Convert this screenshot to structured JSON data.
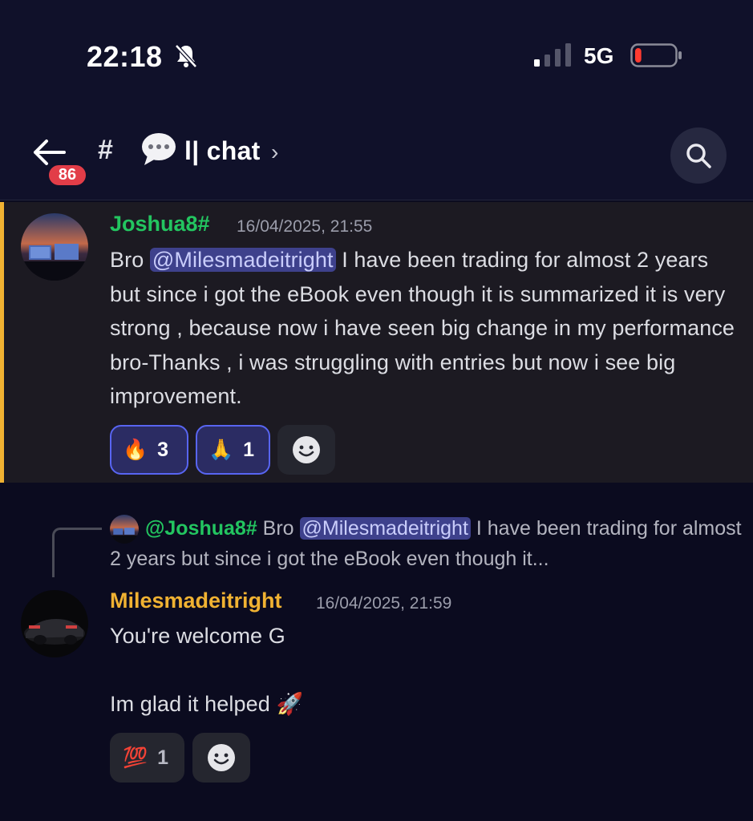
{
  "status_bar": {
    "time": "22:18",
    "network": "5G",
    "bell_icon": "bell-slash-icon",
    "battery_level_percent": 10
  },
  "header": {
    "unread_badge": "86",
    "channel_hash": "#",
    "channel_emoji": "speech-bubble-icon",
    "channel_name": "l| chat",
    "chevron": "›"
  },
  "messages": [
    {
      "author": "Joshua8#",
      "author_color": "#23c560",
      "timestamp": "16/04/2025, 21:55",
      "text_before_mention": "Bro ",
      "mention": "@Milesmadeitright",
      "text_after_mention": " I have been trading for almost 2 years but since i got the eBook even though  it is summarized it is very strong , because now i have seen big change in my performance bro-Thanks ,  i was struggling with entries but now i see big improvement.",
      "reactions": [
        {
          "emoji": "🔥",
          "count": "3",
          "me": true
        },
        {
          "emoji": "🙏",
          "count": "1",
          "me": true
        }
      ]
    },
    {
      "reply_to": {
        "author": "@Joshua8#",
        "text_before_mention": " Bro ",
        "mention": "@Milesmadeitright",
        "text_after_mention": " I have been trading for almost 2 years but since i got the eBook even though  it..."
      },
      "author": "Milesmadeitright",
      "author_color": "#f0b232",
      "timestamp": "16/04/2025, 21:59",
      "line1": "You're welcome G",
      "line2": "Im glad it helped",
      "line2_emoji": "🚀",
      "reactions": [
        {
          "emoji": "💯",
          "count": "1",
          "me": false
        }
      ]
    }
  ]
}
